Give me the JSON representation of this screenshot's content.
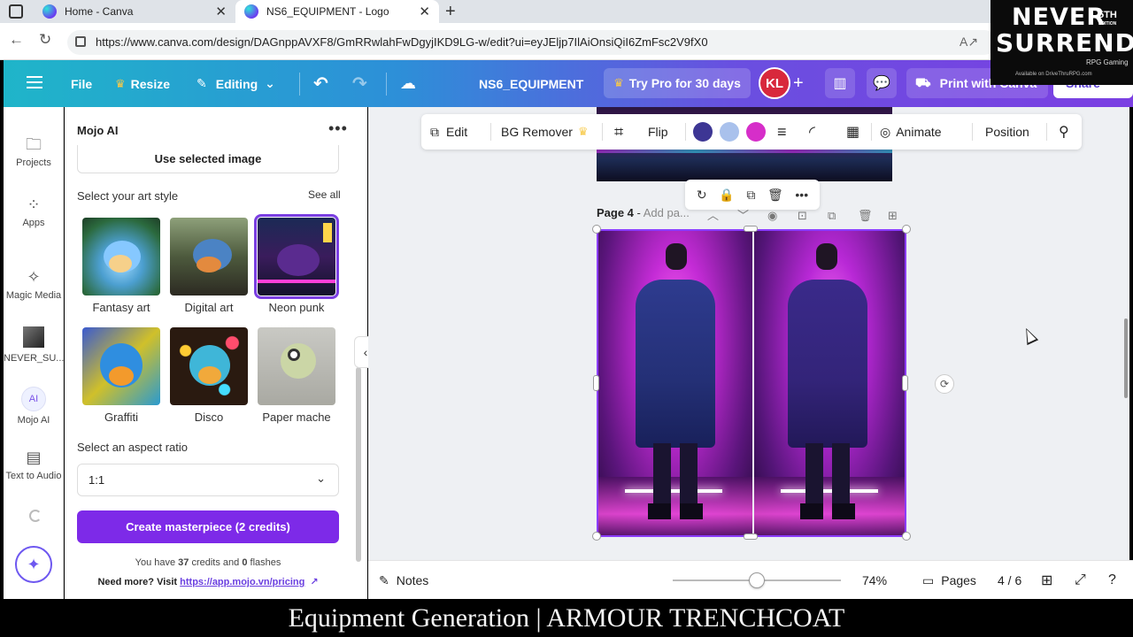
{
  "browser": {
    "tabs": [
      {
        "title": "Home - Canva"
      },
      {
        "title": "NS6_EQUIPMENT - Logo"
      }
    ],
    "url": "https://www.canva.com/design/DAGnppAVXF8/GmRRwlahFwDgyjIKD9LG-w/edit?ui=eyJEljp7IlAiOnsiQiI6ZmFsc2V9fX0"
  },
  "header": {
    "file": "File",
    "resize": "Resize",
    "editing": "Editing",
    "doc_title": "NS6_EQUIPMENT",
    "try_pro": "Try Pro for 30 days",
    "avatar": "KL",
    "print": "Print with Canva",
    "share": "Share"
  },
  "rail": {
    "projects": "Projects",
    "apps": "Apps",
    "magic_media": "Magic Media",
    "never_su": "NEVER_SU...",
    "mojo_ai": "Mojo AI",
    "mojo_badge": "AI",
    "text_to_audio": "Text to Audio"
  },
  "panel": {
    "title": "Mojo AI",
    "use_selected": "Use selected image",
    "select_style": "Select your art style",
    "see_all": "See all",
    "styles": [
      {
        "label": "Fantasy art"
      },
      {
        "label": "Digital art"
      },
      {
        "label": "Neon punk"
      },
      {
        "label": "Graffiti"
      },
      {
        "label": "Disco"
      },
      {
        "label": "Paper mache"
      }
    ],
    "selected_style": "Neon punk",
    "aspect_label": "Select an aspect ratio",
    "aspect_value": "1:1",
    "create_button": "Create masterpiece (2 credits)",
    "credits_prefix": "You have ",
    "credits_count": "37",
    "credits_mid": " credits and ",
    "flashes_count": "0",
    "flashes_suffix": " flashes",
    "need_more": "Need more? Visit ",
    "pricing_link": "https://app.mojo.vn/pricing"
  },
  "context_toolbar": {
    "edit": "Edit",
    "bg_remover": "BG Remover",
    "flip": "Flip",
    "colors": [
      "#3d3694",
      "#a9c1ec",
      "#d62ec9"
    ],
    "animate": "Animate",
    "position": "Position"
  },
  "canvas": {
    "page_label": "Page 4",
    "page_add": "Add pa...",
    "image_alt": "Neon cyberpunk armour trenchcoat front and back view"
  },
  "footer": {
    "notes": "Notes",
    "zoom_value": 0.5,
    "zoom": "74%",
    "pages": "Pages",
    "page_count": "4 / 6"
  },
  "caption": "Equipment Generation | ARMOUR TRENCHCOAT",
  "watermark": {
    "line1": "NEVER",
    "line2": "SURRENDER",
    "edition": "5TH",
    "edition_small": "EDITION",
    "tagline": "RPG Gaming",
    "available": "Available on DriveThruRPG.com"
  }
}
